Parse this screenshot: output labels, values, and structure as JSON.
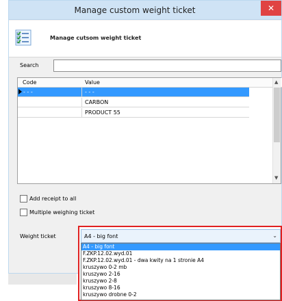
{
  "window": {
    "title": "Manage custom weight ticket",
    "close_glyph": "✕"
  },
  "header": {
    "title": "Manage cutsom weight ticket",
    "icon": "checklist-icon"
  },
  "search": {
    "label": "Search",
    "value": ""
  },
  "grid": {
    "columns": [
      "Code",
      "Value"
    ],
    "rows": [
      {
        "code": "- - -",
        "value": "- - -",
        "selected": true
      },
      {
        "code": "",
        "value": "CARBON",
        "selected": false
      },
      {
        "code": "",
        "value": "PRODUCT 55",
        "selected": false
      }
    ]
  },
  "options": {
    "add_receipt_label": "Add receipt to all",
    "multiple_weighing_label": "Multiple weighing ticket"
  },
  "weight_ticket": {
    "label": "Weight ticket",
    "selected": "A4 - big font",
    "items": [
      "A4 - big font",
      "F.ZKP.12.02.wyd.01",
      "F.ZKP.12.02.wyd.01 - dwa kwity na 1 stronie A4",
      "kruszywo 0-2 mb",
      "kruszywo 2-16",
      "kruszywo 2-8",
      "kruszywo 8-16",
      "kruszywo drobne 0-2"
    ]
  },
  "colors": {
    "selection": "#3399ff",
    "highlight_border": "#e02020"
  }
}
